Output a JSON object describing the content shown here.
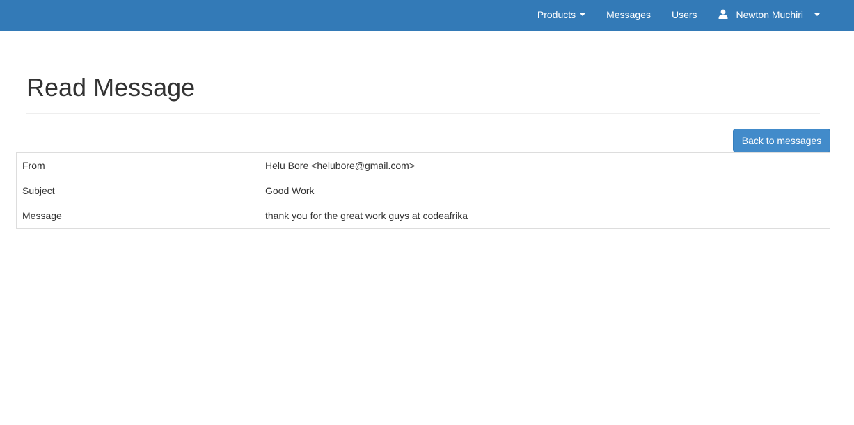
{
  "navbar": {
    "products_label": "Products",
    "messages_label": "Messages",
    "users_label": "Users",
    "user_name": "Newton Muchiri",
    "icons": {
      "user": "user-icon",
      "caret": "caret-down-icon"
    },
    "colors": {
      "navbar_bg": "#337ab7",
      "text": "#ffffff"
    }
  },
  "page": {
    "title": "Read Message"
  },
  "actions": {
    "back_label": "Back to messages",
    "colors": {
      "button_bg": "#428bca"
    }
  },
  "message": {
    "rows": [
      {
        "label": "From",
        "value": "Helu Bore <helubore@gmail.com>"
      },
      {
        "label": "Subject",
        "value": "Good Work"
      },
      {
        "label": "Message",
        "value": "thank you for the great work guys at codeafrika"
      }
    ]
  }
}
